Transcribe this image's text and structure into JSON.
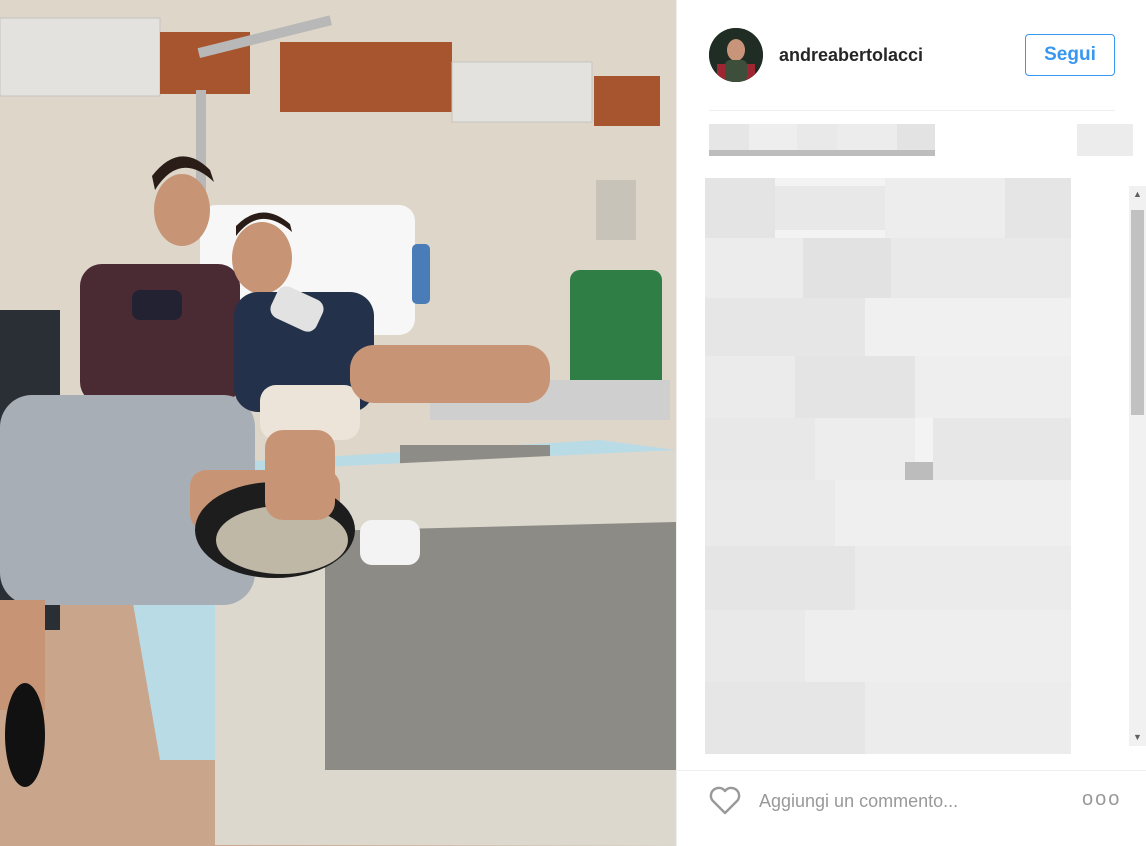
{
  "post": {
    "username": "andreabertolacci",
    "follow_label": "Segui",
    "comment_placeholder": "Aggiungi un commento...",
    "more_label": "ooo"
  },
  "icons": {
    "like": "heart-icon",
    "more": "more-options-icon",
    "scroll_up": "scroll-up-arrow-icon",
    "scroll_down": "scroll-down-arrow-icon"
  },
  "colors": {
    "accent": "#3897f0",
    "text": "#262626",
    "muted": "#999999",
    "border": "#efefef"
  }
}
